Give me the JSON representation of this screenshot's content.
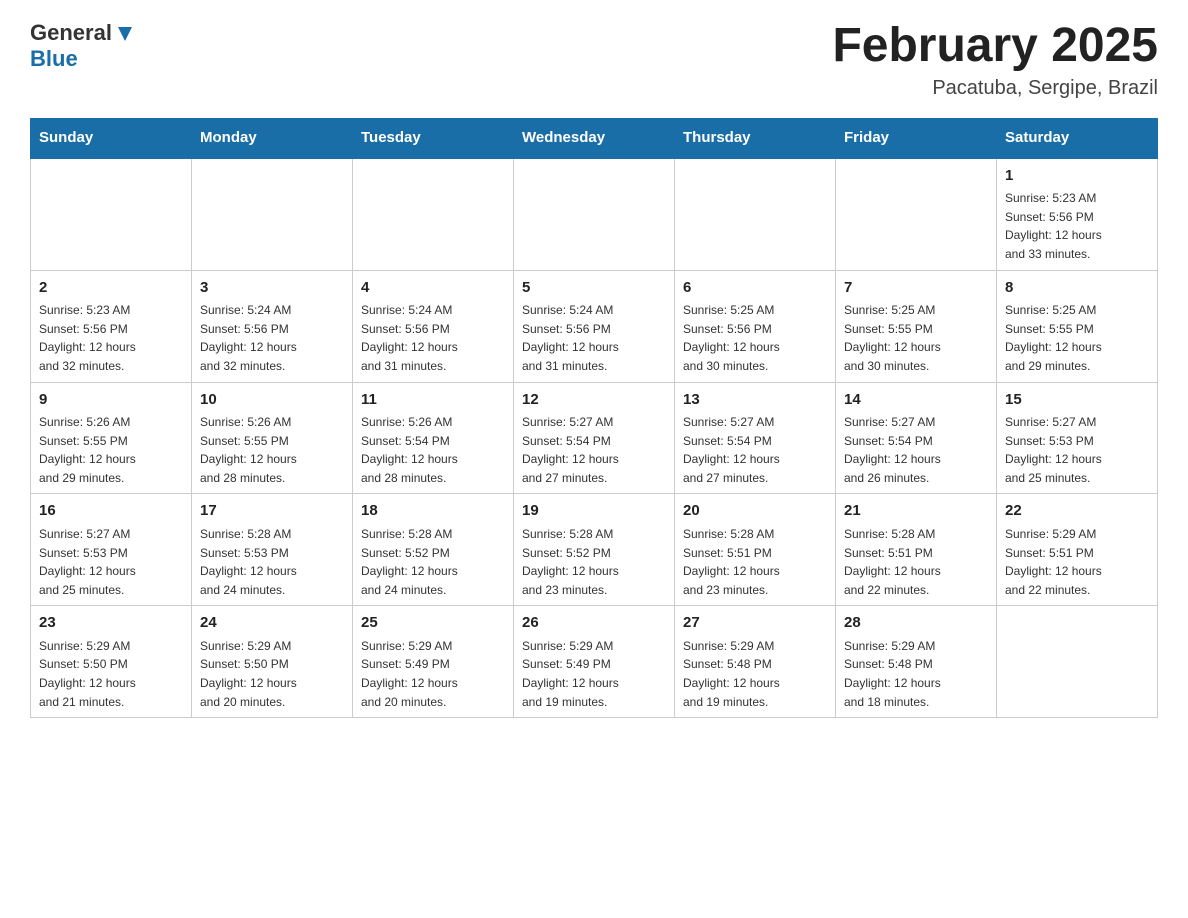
{
  "header": {
    "logo_general": "General",
    "logo_blue": "Blue",
    "title": "February 2025",
    "subtitle": "Pacatuba, Sergipe, Brazil"
  },
  "weekdays": [
    "Sunday",
    "Monday",
    "Tuesday",
    "Wednesday",
    "Thursday",
    "Friday",
    "Saturday"
  ],
  "weeks": [
    [
      {
        "day": "",
        "info": ""
      },
      {
        "day": "",
        "info": ""
      },
      {
        "day": "",
        "info": ""
      },
      {
        "day": "",
        "info": ""
      },
      {
        "day": "",
        "info": ""
      },
      {
        "day": "",
        "info": ""
      },
      {
        "day": "1",
        "info": "Sunrise: 5:23 AM\nSunset: 5:56 PM\nDaylight: 12 hours\nand 33 minutes."
      }
    ],
    [
      {
        "day": "2",
        "info": "Sunrise: 5:23 AM\nSunset: 5:56 PM\nDaylight: 12 hours\nand 32 minutes."
      },
      {
        "day": "3",
        "info": "Sunrise: 5:24 AM\nSunset: 5:56 PM\nDaylight: 12 hours\nand 32 minutes."
      },
      {
        "day": "4",
        "info": "Sunrise: 5:24 AM\nSunset: 5:56 PM\nDaylight: 12 hours\nand 31 minutes."
      },
      {
        "day": "5",
        "info": "Sunrise: 5:24 AM\nSunset: 5:56 PM\nDaylight: 12 hours\nand 31 minutes."
      },
      {
        "day": "6",
        "info": "Sunrise: 5:25 AM\nSunset: 5:56 PM\nDaylight: 12 hours\nand 30 minutes."
      },
      {
        "day": "7",
        "info": "Sunrise: 5:25 AM\nSunset: 5:55 PM\nDaylight: 12 hours\nand 30 minutes."
      },
      {
        "day": "8",
        "info": "Sunrise: 5:25 AM\nSunset: 5:55 PM\nDaylight: 12 hours\nand 29 minutes."
      }
    ],
    [
      {
        "day": "9",
        "info": "Sunrise: 5:26 AM\nSunset: 5:55 PM\nDaylight: 12 hours\nand 29 minutes."
      },
      {
        "day": "10",
        "info": "Sunrise: 5:26 AM\nSunset: 5:55 PM\nDaylight: 12 hours\nand 28 minutes."
      },
      {
        "day": "11",
        "info": "Sunrise: 5:26 AM\nSunset: 5:54 PM\nDaylight: 12 hours\nand 28 minutes."
      },
      {
        "day": "12",
        "info": "Sunrise: 5:27 AM\nSunset: 5:54 PM\nDaylight: 12 hours\nand 27 minutes."
      },
      {
        "day": "13",
        "info": "Sunrise: 5:27 AM\nSunset: 5:54 PM\nDaylight: 12 hours\nand 27 minutes."
      },
      {
        "day": "14",
        "info": "Sunrise: 5:27 AM\nSunset: 5:54 PM\nDaylight: 12 hours\nand 26 minutes."
      },
      {
        "day": "15",
        "info": "Sunrise: 5:27 AM\nSunset: 5:53 PM\nDaylight: 12 hours\nand 25 minutes."
      }
    ],
    [
      {
        "day": "16",
        "info": "Sunrise: 5:27 AM\nSunset: 5:53 PM\nDaylight: 12 hours\nand 25 minutes."
      },
      {
        "day": "17",
        "info": "Sunrise: 5:28 AM\nSunset: 5:53 PM\nDaylight: 12 hours\nand 24 minutes."
      },
      {
        "day": "18",
        "info": "Sunrise: 5:28 AM\nSunset: 5:52 PM\nDaylight: 12 hours\nand 24 minutes."
      },
      {
        "day": "19",
        "info": "Sunrise: 5:28 AM\nSunset: 5:52 PM\nDaylight: 12 hours\nand 23 minutes."
      },
      {
        "day": "20",
        "info": "Sunrise: 5:28 AM\nSunset: 5:51 PM\nDaylight: 12 hours\nand 23 minutes."
      },
      {
        "day": "21",
        "info": "Sunrise: 5:28 AM\nSunset: 5:51 PM\nDaylight: 12 hours\nand 22 minutes."
      },
      {
        "day": "22",
        "info": "Sunrise: 5:29 AM\nSunset: 5:51 PM\nDaylight: 12 hours\nand 22 minutes."
      }
    ],
    [
      {
        "day": "23",
        "info": "Sunrise: 5:29 AM\nSunset: 5:50 PM\nDaylight: 12 hours\nand 21 minutes."
      },
      {
        "day": "24",
        "info": "Sunrise: 5:29 AM\nSunset: 5:50 PM\nDaylight: 12 hours\nand 20 minutes."
      },
      {
        "day": "25",
        "info": "Sunrise: 5:29 AM\nSunset: 5:49 PM\nDaylight: 12 hours\nand 20 minutes."
      },
      {
        "day": "26",
        "info": "Sunrise: 5:29 AM\nSunset: 5:49 PM\nDaylight: 12 hours\nand 19 minutes."
      },
      {
        "day": "27",
        "info": "Sunrise: 5:29 AM\nSunset: 5:48 PM\nDaylight: 12 hours\nand 19 minutes."
      },
      {
        "day": "28",
        "info": "Sunrise: 5:29 AM\nSunset: 5:48 PM\nDaylight: 12 hours\nand 18 minutes."
      },
      {
        "day": "",
        "info": ""
      }
    ]
  ]
}
